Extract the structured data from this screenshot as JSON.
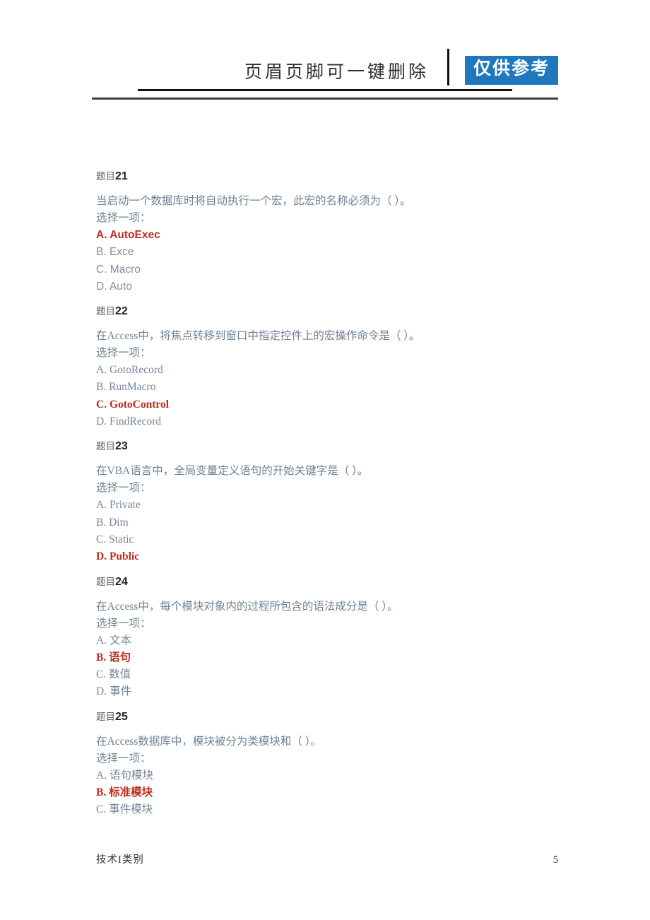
{
  "header": {
    "title": "页眉页脚可一键删除",
    "badge": "仅供参考",
    "badge_color": "#1f77be"
  },
  "document": {
    "question_label_prefix": "题目",
    "choose_prompt": "选择一项：",
    "correct_color": "#bf2c1d",
    "body_text_color": "#6f8193"
  },
  "questions": [
    {
      "label_prefix": "题目",
      "number": "21",
      "text": "当启动一个数据库时将自动执行一个宏，此宏的名称必须为（ ）。",
      "prompt": "选择一项：",
      "font": "sans",
      "options": [
        {
          "text": "A. AutoExec",
          "correct": true
        },
        {
          "text": "B. Exce",
          "correct": false
        },
        {
          "text": "C. Macro",
          "correct": false
        },
        {
          "text": "D. Auto",
          "correct": false
        }
      ]
    },
    {
      "label_prefix": "题目",
      "number": "22",
      "text": "在Access中，将焦点转移到窗口中指定控件上的宏操作命令是（ ）。",
      "prompt": "选择一项：",
      "font": "serif",
      "options": [
        {
          "text": "A. GotoRecord",
          "correct": false
        },
        {
          "text": "B. RunMacro",
          "correct": false
        },
        {
          "text": "C. GotoControl",
          "correct": true
        },
        {
          "text": "D. FindRecord",
          "correct": false
        }
      ]
    },
    {
      "label_prefix": "题目",
      "number": "23",
      "text": "在VBA语言中，全局变量定义语句的开始关键字是（ ）。",
      "prompt": "选择一项：",
      "font": "serif",
      "options": [
        {
          "text": "A. Private",
          "correct": false
        },
        {
          "text": "B. Dim",
          "correct": false
        },
        {
          "text": "C. Static",
          "correct": false
        },
        {
          "text": "D. Public",
          "correct": true
        }
      ]
    },
    {
      "label_prefix": "题目",
      "number": "24",
      "text": "在Access中，每个模块对象内的过程所包含的语法成分是（ ）。",
      "prompt": "选择一项：",
      "font": "serif",
      "options": [
        {
          "text": "A. 文本",
          "correct": false
        },
        {
          "text": "B. 语句",
          "correct": true
        },
        {
          "text": "C. 数值",
          "correct": false
        },
        {
          "text": "D. 事件",
          "correct": false
        }
      ]
    },
    {
      "label_prefix": "题目",
      "number": "25",
      "text": "在Access数据库中，模块被分为类模块和（ ）。",
      "prompt": "选择一项：",
      "font": "serif",
      "options": [
        {
          "text": "A. 语句模块",
          "correct": false
        },
        {
          "text": "B. 标准模块",
          "correct": true
        },
        {
          "text": "C. 事件模块",
          "correct": false
        }
      ]
    }
  ],
  "footer": {
    "left": "技术I类别",
    "page_number": "5"
  }
}
